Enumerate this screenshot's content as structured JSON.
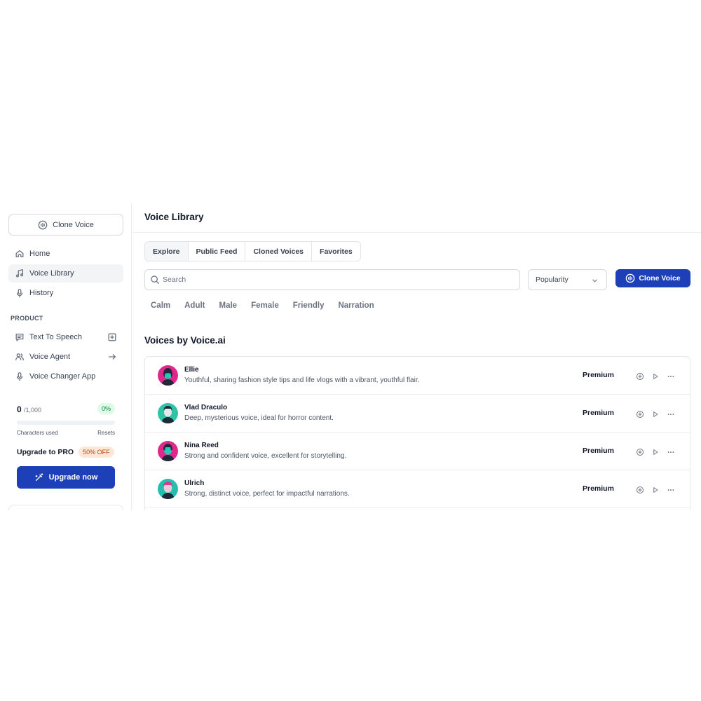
{
  "sidebar": {
    "clone_voice_label": "Clone Voice",
    "nav": [
      {
        "label": "Home",
        "icon": "home-icon",
        "active": false
      },
      {
        "label": "Voice Library",
        "icon": "music-note-icon",
        "active": true
      },
      {
        "label": "History",
        "icon": "microphone-icon",
        "active": false
      }
    ],
    "product_label": "PRODUCT",
    "product_items": [
      {
        "label": "Text To Speech",
        "icon": "chat-icon",
        "trail": "plus-square-icon"
      },
      {
        "label": "Voice Agent",
        "icon": "users-icon",
        "trail": "arrow-right-icon"
      },
      {
        "label": "Voice Changer App",
        "icon": "microphone-icon",
        "trail": ""
      }
    ],
    "usage": {
      "used": "0",
      "max": "/1,000",
      "percent_label": "0%",
      "progress_fraction": 0,
      "characters_used_label": "Characters used",
      "resets_label": "Resets"
    },
    "upgrade_label": "Upgrade to PRO",
    "discount_label": "50% OFF",
    "upgrade_button_label": "Upgrade now"
  },
  "main": {
    "title": "Voice Library",
    "tabs": [
      "Explore",
      "Public Feed",
      "Cloned Voices",
      "Favorites"
    ],
    "search_placeholder": "Search",
    "sort_value": "Popularity",
    "clone_button_label": "Clone Voice",
    "filters": [
      "Calm",
      "Adult",
      "Male",
      "Female",
      "Friendly",
      "Narration"
    ],
    "section_title": "Voices by Voice.ai",
    "voices": [
      {
        "name": "Ellie",
        "description": "Youthful, sharing fashion style tips and life vlogs with a vibrant, youthful flair.",
        "tier": "Premium",
        "avatar_bg": "#e0288c",
        "avatar_fg": "#27c7b8"
      },
      {
        "name": "Vlad Draculo",
        "description": "Deep, mysterious voice, ideal for horror content.",
        "tier": "Premium",
        "avatar_bg": "#2ec4a6",
        "avatar_fg": "#1f2937"
      },
      {
        "name": "Nina Reed",
        "description": "Strong and confident voice, excellent for storytelling.",
        "tier": "Premium",
        "avatar_bg": "#e0288c",
        "avatar_fg": "#27c7b8"
      },
      {
        "name": "Ulrich",
        "description": "Strong, distinct voice, perfect for impactful narrations.",
        "tier": "Premium",
        "avatar_bg": "#25bfb0",
        "avatar_fg": "#d63c8c"
      }
    ]
  },
  "colors": {
    "accent": "#1d3fb8",
    "success": "#22c55e",
    "discount": "#c2410c"
  }
}
